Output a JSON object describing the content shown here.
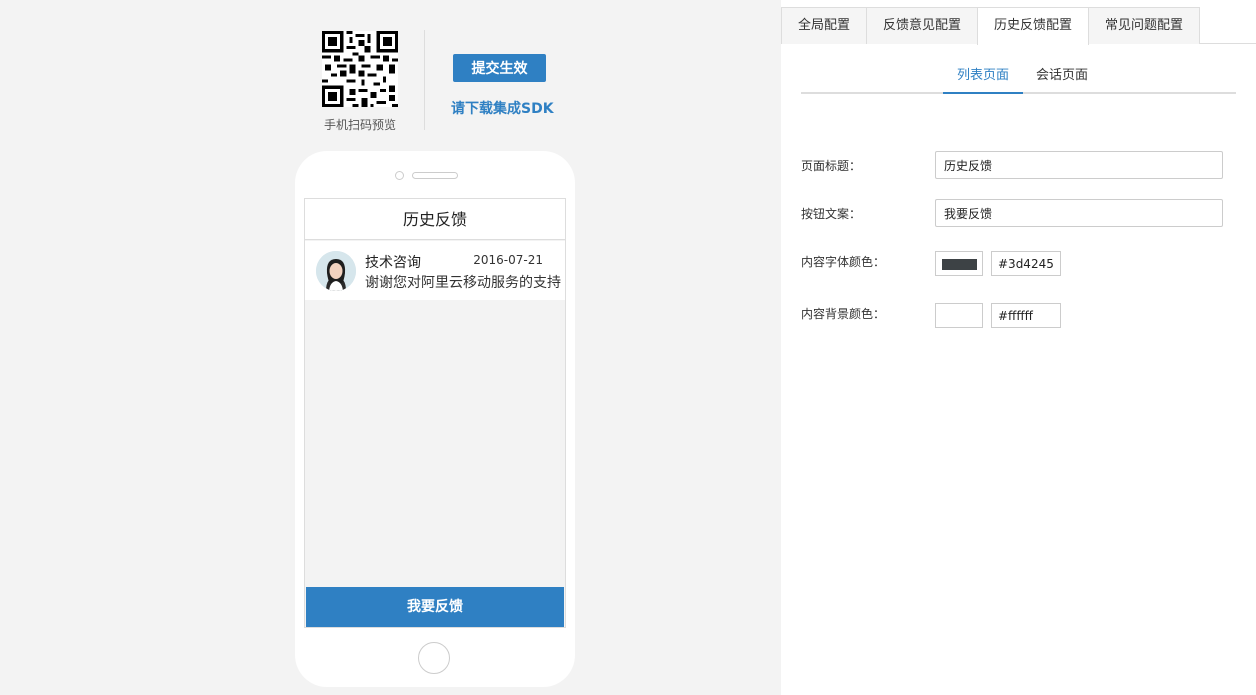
{
  "preview": {
    "qr_caption": "手机扫码预览",
    "submit_label": "提交生效",
    "sdk_link": "请下载集成SDK",
    "phone": {
      "title": "历史反馈",
      "item": {
        "name": "技术咨询",
        "date": "2016-07-21",
        "content": "谢谢您对阿里云移动服务的支持"
      },
      "button": "我要反馈"
    }
  },
  "config": {
    "tabs": [
      {
        "label": "全局配置",
        "active": false
      },
      {
        "label": "反馈意见配置",
        "active": false
      },
      {
        "label": "历史反馈配置",
        "active": true
      },
      {
        "label": "常见问题配置",
        "active": false
      }
    ],
    "subtabs": [
      {
        "label": "列表页面",
        "active": true
      },
      {
        "label": "会话页面",
        "active": false
      }
    ],
    "form": {
      "title_label": "页面标题：",
      "title_value": "历史反馈",
      "button_label": "按钮文案：",
      "button_value": "我要反馈",
      "font_color_label": "内容字体颜色：",
      "font_color": "#3d4245",
      "bg_color_label": "内容背景颜色：",
      "bg_color": "#ffffff"
    }
  },
  "colors": {
    "accent": "#2f80c3",
    "panel_bg": "#f3f3f3"
  }
}
